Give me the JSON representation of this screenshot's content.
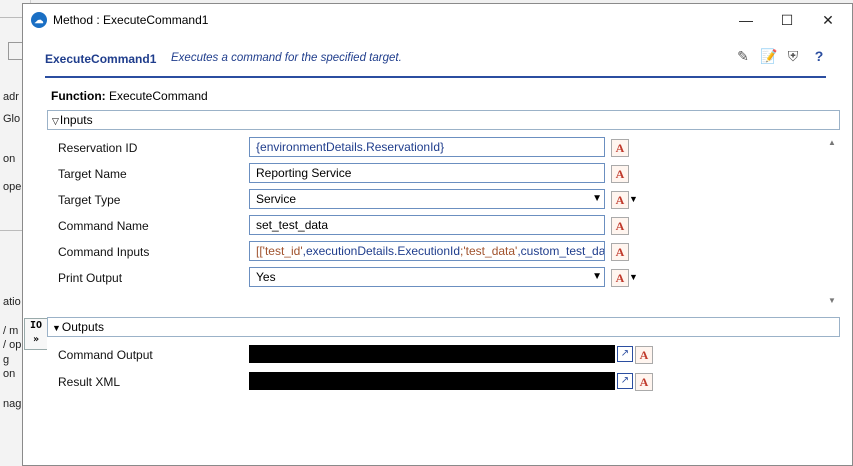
{
  "window": {
    "title": "Method : ExecuteCommand1"
  },
  "header": {
    "method_name": "ExecuteCommand1",
    "description": "Executes a command for the specified target."
  },
  "function": {
    "label": "Function:",
    "value": "ExecuteCommand"
  },
  "inputs": {
    "section_label": "Inputs",
    "rows": [
      {
        "label": "Reservation ID",
        "value_parts": [
          "{",
          "environmentDetails",
          ".ReservationId}"
        ]
      },
      {
        "label": "Target Name",
        "value": "Reporting Service"
      },
      {
        "label": "Target Type",
        "value": "Service"
      },
      {
        "label": "Command Name",
        "value": "set_test_data"
      },
      {
        "label": "Command Inputs",
        "value_parts": [
          "[['test_id'",
          ",executionDetails.",
          "ExecutionId",
          ";'test_data'",
          ",custom_test_data]]"
        ]
      },
      {
        "label": "Print Output",
        "value": "Yes"
      }
    ]
  },
  "outputs": {
    "section_label": "Outputs",
    "rows": [
      {
        "label": "Command Output"
      },
      {
        "label": "Result XML"
      }
    ]
  },
  "side_tab": {
    "label": "IO"
  },
  "background_fragments": [
    "adr",
    "Glo",
    "on",
    "ope",
    "atio",
    "/ m",
    "/ op",
    "g",
    "on",
    "nag"
  ]
}
